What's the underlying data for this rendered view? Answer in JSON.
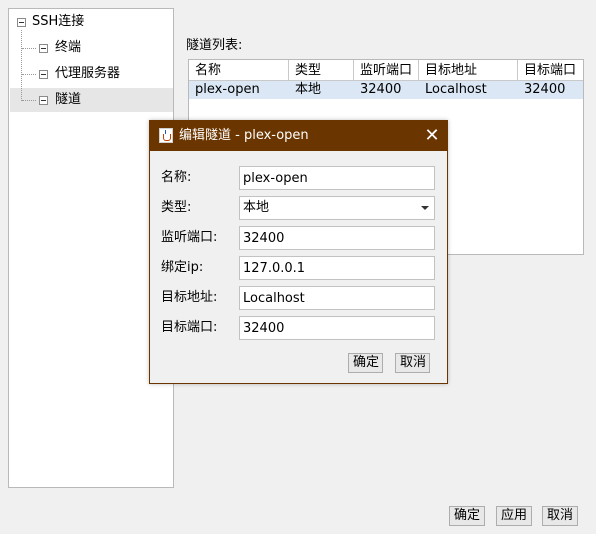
{
  "tree": {
    "root": "SSH连接",
    "children": [
      {
        "label": "终端"
      },
      {
        "label": "代理服务器"
      },
      {
        "label": "隧道"
      }
    ]
  },
  "tunnel_list": {
    "label": "隧道列表:",
    "columns": [
      "名称",
      "类型",
      "监听端口",
      "目标地址",
      "目标端口"
    ],
    "rows": [
      [
        "plex-open",
        "本地",
        "32400",
        "Localhost",
        "32400"
      ]
    ]
  },
  "dialog": {
    "title": "编辑隧道 - plex-open",
    "fields": {
      "name": {
        "label": "名称:",
        "value": "plex-open"
      },
      "type": {
        "label": "类型:",
        "value": "本地"
      },
      "listen": {
        "label": "监听端口:",
        "value": "32400"
      },
      "bind": {
        "label": "绑定ip:",
        "value": "127.0.0.1"
      },
      "host": {
        "label": "目标地址:",
        "value": "Localhost"
      },
      "port": {
        "label": "目标端口:",
        "value": "32400"
      }
    },
    "ok_label": "确定",
    "cancel_label": "取消"
  },
  "footer": {
    "ok_label": "确定",
    "apply_label": "应用",
    "cancel_label": "取消"
  },
  "colors": {
    "dialog_titlebar": "#6b3500",
    "row_selected": "#dbe7f5"
  }
}
